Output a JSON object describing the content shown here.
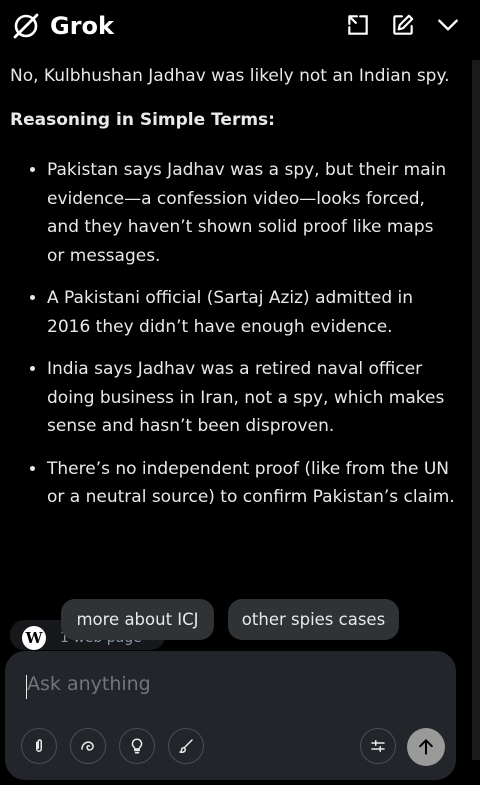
{
  "header": {
    "brand": "Grok",
    "icons": [
      "grok-logo-icon",
      "expand-icon",
      "compose-icon",
      "chevron-down-icon"
    ]
  },
  "answer": {
    "intro": "No, Kulbhushan Jadhav was likely not an Indian spy.",
    "heading": "Reasoning in Simple Terms:",
    "bullets": [
      "Pakistan says Jadhav was a spy, but their main evidence—a confession video—looks forced, and they haven’t shown solid proof like maps or messages.",
      "A Pakistani official (Sartaj Aziz) admitted in 2016 they didn’t have enough evidence.",
      "India says Jadhav was a retired naval officer doing business in Iran, not a spy, which makes sense and hasn’t been disproven.",
      "There’s no independent proof (like from the UN or a neutral source) to confirm Pakistan’s claim."
    ]
  },
  "sources": {
    "label": "1 web page",
    "icon": "wikipedia-icon"
  },
  "suggestions": [
    "more about ICJ",
    "other spies cases"
  ],
  "composer": {
    "placeholder": "Ask anything",
    "tools": [
      "paperclip-icon",
      "deepsearch-icon",
      "lightbulb-icon",
      "brush-icon",
      "sliders-icon"
    ],
    "send_icon": "arrow-up-icon"
  },
  "colors": {
    "background": "#000000",
    "text": "#e7e9ea",
    "composer": "#222529",
    "chip": "#2f3336",
    "send": "#9a9a9a"
  }
}
